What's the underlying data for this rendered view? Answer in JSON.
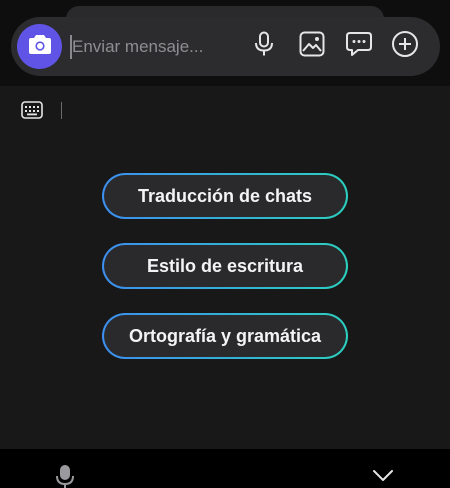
{
  "input": {
    "placeholder": "Enviar mensaje..."
  },
  "icons": {
    "camera": "camera-icon",
    "mic": "microphone-icon",
    "gallery": "image-icon",
    "chat": "chat-bubble-icon",
    "add": "plus-circle-icon",
    "keyboard": "keyboard-icon",
    "nav_mic": "microphone-icon",
    "nav_hide": "chevron-down-icon"
  },
  "suggestions": [
    {
      "label": "Traducción de chats"
    },
    {
      "label": "Estilo de escritura"
    },
    {
      "label": "Ortografía y gramática"
    }
  ],
  "colors": {
    "accent": "#6054e6",
    "gradient_start": "#3d8ff0",
    "gradient_end": "#2bd0bf"
  }
}
